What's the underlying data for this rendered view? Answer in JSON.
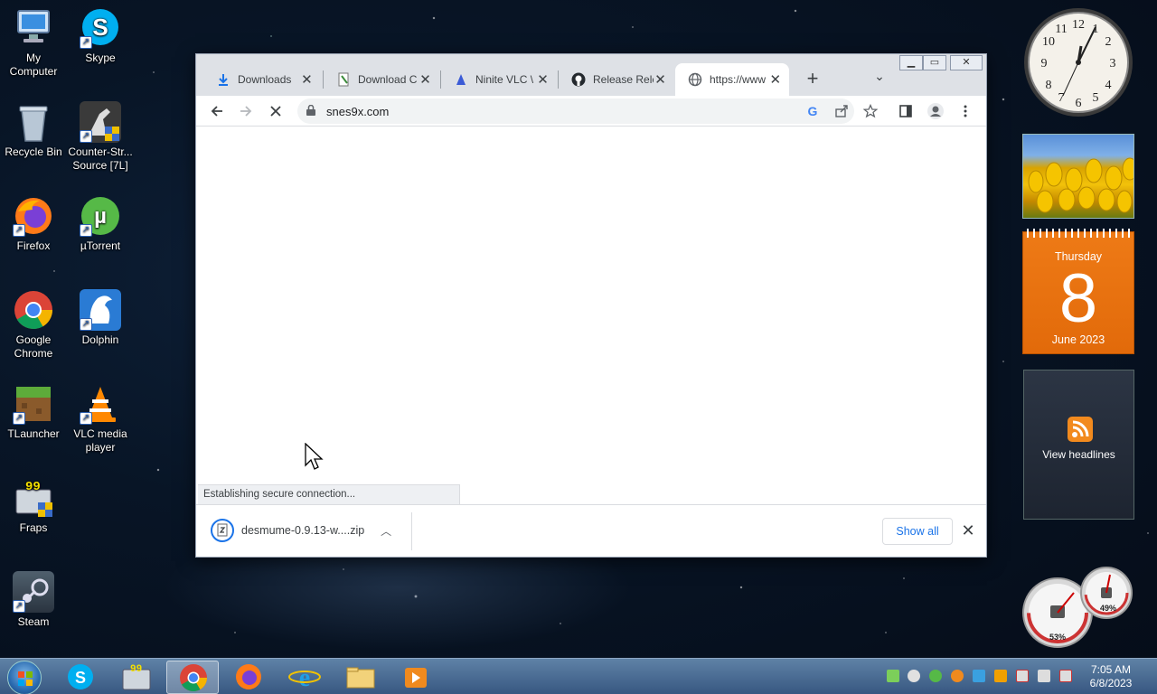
{
  "desktop": {
    "icons": [
      {
        "label": "My\nComputer",
        "icon": "computer-icon"
      },
      {
        "label": "Skype",
        "icon": "skype-icon"
      },
      {
        "label": "Recycle Bin",
        "icon": "recycle-bin-icon"
      },
      {
        "label": "Counter-Str... Source [7L]",
        "icon": "counter-strike-icon"
      },
      {
        "label": "Firefox",
        "icon": "firefox-icon"
      },
      {
        "label": "µTorrent",
        "icon": "utorrent-icon"
      },
      {
        "label": "Google Chrome",
        "icon": "chrome-icon"
      },
      {
        "label": "Dolphin",
        "icon": "dolphin-icon"
      },
      {
        "label": "TLauncher",
        "icon": "tlauncher-icon"
      },
      {
        "label": "VLC media player",
        "icon": "vlc-icon"
      },
      {
        "label": "Fraps",
        "icon": "fraps-icon"
      },
      {
        "label": "Steam",
        "icon": "steam-icon"
      }
    ]
  },
  "browser": {
    "tabs": [
      {
        "title": "Downloads",
        "icon": "download-icon"
      },
      {
        "title": "Download C",
        "icon": "notepad-icon"
      },
      {
        "title": "Ninite VLC \\",
        "icon": "ninite-icon"
      },
      {
        "title": "Release Rele",
        "icon": "github-icon"
      },
      {
        "title": "https://www",
        "icon": "globe-icon",
        "active": true
      }
    ],
    "url": "snes9x.com",
    "status_text": "Establishing secure connection...",
    "download_file": "desmume-0.9.13-w....zip",
    "show_all_label": "Show all"
  },
  "gadgets": {
    "calendar_day": "Thursday",
    "calendar_date": "8",
    "calendar_month": "June 2023",
    "feed_label": "View headlines",
    "meter_cpu": "53%",
    "meter_mem": "49%"
  },
  "taskbar": {
    "time": "7:05 AM",
    "date": "6/8/2023"
  }
}
